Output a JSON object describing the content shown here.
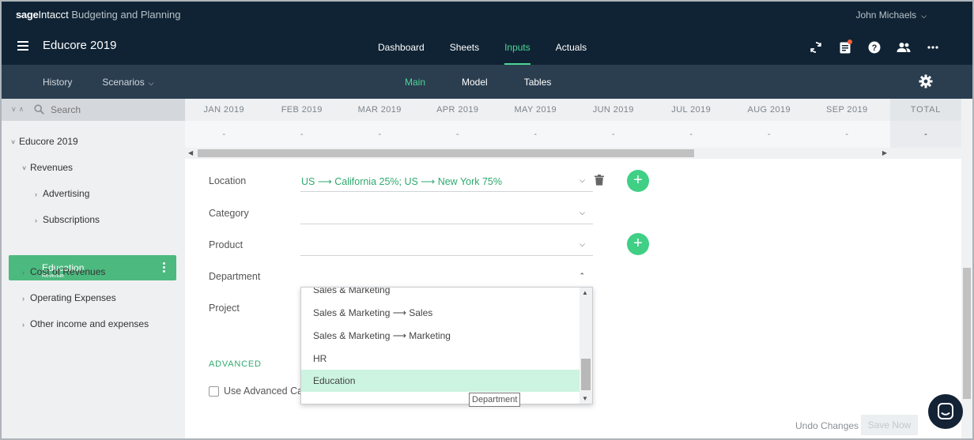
{
  "header": {
    "brand_sage": "sage",
    "brand_intacct": "Intacct",
    "brand_product": "Budgeting and Planning",
    "user_name": "John Michaels",
    "app_title": "Educore 2019",
    "tabs": [
      {
        "label": "Dashboard",
        "active": false
      },
      {
        "label": "Sheets",
        "active": false
      },
      {
        "label": "Inputs",
        "active": true
      },
      {
        "label": "Actuals",
        "active": false
      }
    ],
    "icons": [
      "refresh-icon",
      "clipboard-icon",
      "help-icon",
      "users-icon",
      "more-icon"
    ],
    "notification_color": "#ff5f3b"
  },
  "subbar": {
    "history_label": "History",
    "scenarios_label": "Scenarios",
    "tabs": [
      {
        "label": "Main",
        "active": true
      },
      {
        "label": "Model",
        "active": false
      },
      {
        "label": "Tables",
        "active": false
      }
    ]
  },
  "sidebar": {
    "search_placeholder": "Search",
    "tree": [
      {
        "label": "Educore 2019",
        "arrow": "˅"
      },
      {
        "label": "Revenues",
        "arrow": "˅"
      },
      {
        "label": "Advertising",
        "arrow": "›"
      },
      {
        "label": "Subscriptions",
        "arrow": "›"
      },
      {
        "label": "Cost of Revenues",
        "arrow": "›"
      },
      {
        "label": "Operating Expenses",
        "arrow": "›"
      },
      {
        "label": "Other income and expenses",
        "arrow": "›"
      }
    ],
    "selected": {
      "label": "Education",
      "sub_label": "Revenue"
    }
  },
  "grid": {
    "months": [
      "JAN 2019",
      "FEB 2019",
      "MAR 2019",
      "APR 2019",
      "MAY 2019",
      "JUN 2019",
      "JUL 2019",
      "AUG 2019",
      "SEP 2019"
    ],
    "values": [
      "-",
      "-",
      "-",
      "-",
      "-",
      "-",
      "-",
      "-",
      "-"
    ],
    "total_label": "TOTAL",
    "total_value": "-",
    "scroll_position": 0.73
  },
  "form": {
    "location_label": "Location",
    "location_value": "US ⟶ California 25%; US ⟶ New York 75%",
    "category_label": "Category",
    "category_value": "",
    "product_label": "Product",
    "product_value": "",
    "department_label": "Department",
    "project_label": "Project",
    "advanced_label": "ADVANCED",
    "use_advanced_label": "Use Advanced Calculation"
  },
  "dropdown": {
    "options": [
      {
        "label": "Sales & Marketing",
        "selected": false
      },
      {
        "label": "Sales & Marketing ⟶ Sales",
        "selected": false
      },
      {
        "label": "Sales & Marketing ⟶ Marketing",
        "selected": false
      },
      {
        "label": "HR",
        "selected": false
      },
      {
        "label": "Education",
        "selected": true
      }
    ],
    "tooltip": "Department"
  },
  "footer": {
    "undo_label": "Undo Changes",
    "save_label": "Save Now"
  },
  "colors": {
    "accent": "#4cd696",
    "green_text": "#2eaa6e",
    "selected_bg": "#4cb97f",
    "dark_nav": "#0f2334",
    "sub_nav": "#2b3e50"
  }
}
